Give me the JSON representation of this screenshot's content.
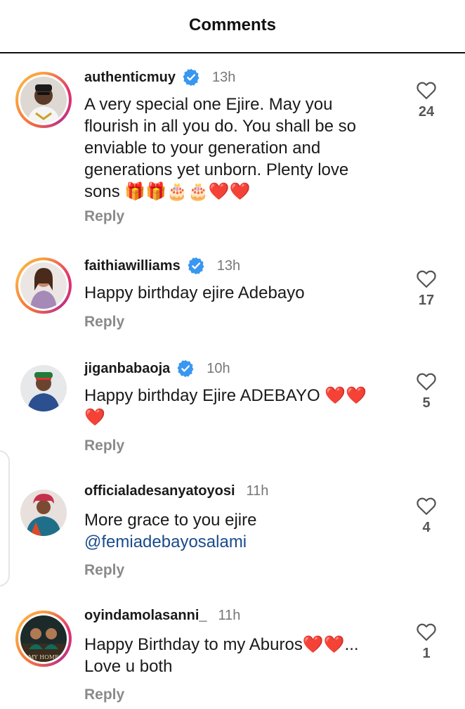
{
  "header": {
    "title": "Comments"
  },
  "reply_label": "Reply",
  "comments": [
    {
      "username": "authenticmuy",
      "verified": true,
      "time": "13h",
      "text": "A very special one Ejire. May you flourish in all you do. You shall be so enviable to your generation and generations yet unborn. Plenty love sons",
      "emojis": "🎁🎁🎂🎂❤️❤️",
      "likes": "24"
    },
    {
      "username": "faithiawilliams",
      "verified": true,
      "time": "13h",
      "text": "Happy birthday ejire Adebayo",
      "likes": "17"
    },
    {
      "username": "jiganbabaoja",
      "verified": true,
      "time": "10h",
      "text": "Happy birthday Ejire ADEBAYO",
      "emojis": "❤️❤️❤️",
      "likes": "5"
    },
    {
      "username": "officialadesanyatoyosi",
      "verified": false,
      "time": "11h",
      "text": "More grace to you ejire",
      "mention": "@femiadebayosalami",
      "likes": "4"
    },
    {
      "username": "oyindamolasanni_",
      "verified": false,
      "time": "11h",
      "text_line1": "Happy Birthday to my Aburos",
      "emojis": "❤️❤️",
      "ellipsis": "...",
      "text_line2": "Love u both",
      "likes": "1"
    }
  ],
  "colors": {
    "verified": "#3897f0",
    "mention": "#1a4b8c",
    "heart": "#d6192b",
    "reply": "#8a8a8a"
  }
}
